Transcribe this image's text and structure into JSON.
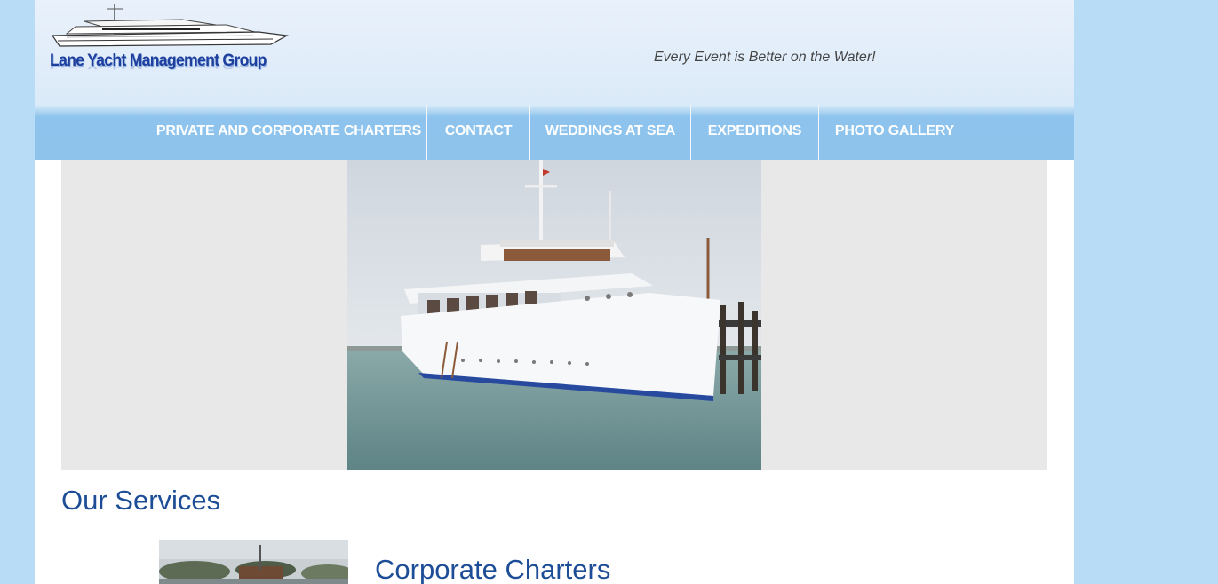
{
  "brand": {
    "logo_text": "Lane Yacht Management Group",
    "tagline": "Every Event is Better on the Water!"
  },
  "nav": {
    "items": [
      {
        "label": "PRIVATE AND CORPORATE CHARTERS"
      },
      {
        "label": "CONTACT"
      },
      {
        "label": "WEDDINGS AT SEA"
      },
      {
        "label": "EXPEDITIONS"
      },
      {
        "label": "PHOTO GALLERY"
      }
    ]
  },
  "main": {
    "services_heading": "Our Services",
    "cards": [
      {
        "title": "Corporate Charters"
      }
    ]
  },
  "colors": {
    "page_background": "#b9dcf6",
    "nav_background": "#8ec4ec",
    "heading": "#1c4d96",
    "hero_background": "#e8e8e8"
  }
}
